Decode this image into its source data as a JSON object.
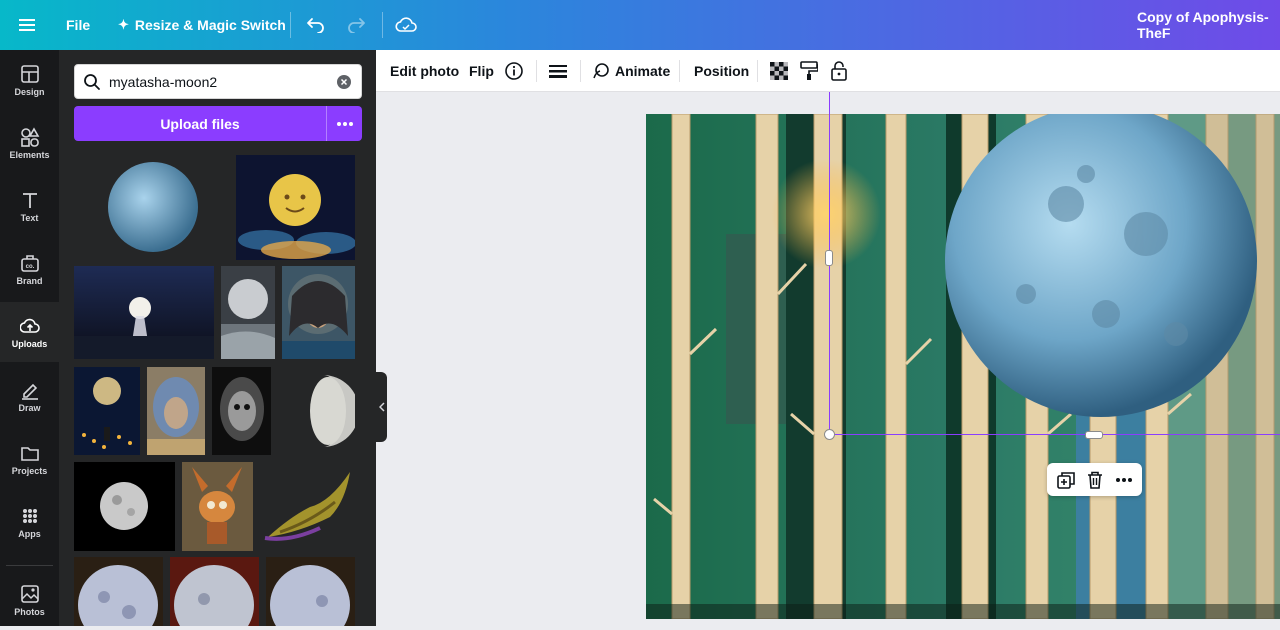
{
  "topbar": {
    "file_label": "File",
    "resize_label": "Resize & Magic Switch",
    "doc_title": "Copy of Apophysis-TheF"
  },
  "rail": {
    "items": [
      {
        "label": "Design"
      },
      {
        "label": "Elements"
      },
      {
        "label": "Text"
      },
      {
        "label": "Brand"
      },
      {
        "label": "Uploads"
      },
      {
        "label": "Draw"
      },
      {
        "label": "Projects"
      },
      {
        "label": "Apps"
      },
      {
        "label": "Photos"
      }
    ],
    "active": "Uploads"
  },
  "panel": {
    "search_value": "myatasha-moon2",
    "upload_label": "Upload files"
  },
  "context_toolbar": {
    "edit_photo": "Edit photo",
    "flip": "Flip",
    "animate": "Animate",
    "position": "Position"
  },
  "colors": {
    "accent": "#8b3dff",
    "selection": "#8b3dff",
    "rail_bg": "#18191b",
    "panel_bg": "#252627"
  },
  "icons": [
    "menu-icon",
    "cloud-save-icon",
    "undo-icon",
    "redo-icon",
    "search-icon",
    "clear-icon",
    "info-icon",
    "transparency-icon",
    "copy-style-icon",
    "lock-icon",
    "duplicate-icon",
    "trash-icon",
    "more-icon"
  ]
}
